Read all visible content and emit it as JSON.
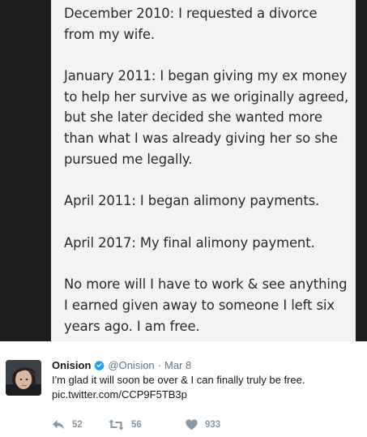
{
  "note": {
    "paragraphs": [
      "December 2010: I requested a divorce\nfrom my wife.",
      "January 2011: I began giving my ex money\nto help her survive as we originally agreed,\nbut she later decided she wanted more\nthan what I was already giving her so she\npursued me legally.",
      "April 2011: I began alimony payments.",
      "April 2017: My final alimony payment.",
      "No more will I have to work & see anything\nI earned given away to someone I left six\nyears ago. I am free."
    ]
  },
  "tweet": {
    "author_name": "Onision",
    "handle": "@Onision",
    "separator": "·",
    "date": "Mar 8",
    "text": "I'm glad it will soon be over & I can finally truly be free.",
    "link": "pic.twitter.com/CCP9F5TB3p",
    "replies": "52",
    "retweets": "56",
    "likes": "933"
  },
  "colors": {
    "verified_blue": "#1da1f2",
    "action_gray": "#8899a6",
    "secondary_text": "#657786"
  }
}
